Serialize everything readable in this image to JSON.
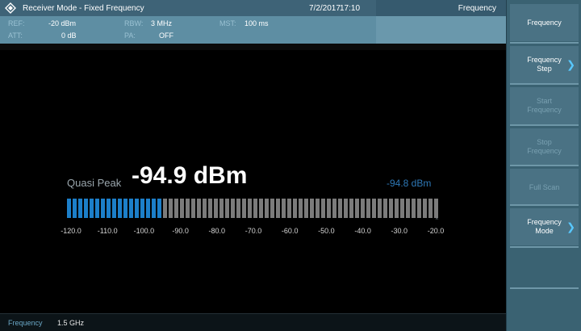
{
  "titlebar": {
    "title": "Receiver Mode - Fixed Frequency",
    "date": "7/2/2017",
    "time": "17:10",
    "right_title": "Frequency"
  },
  "info": {
    "ref_label": "REF:",
    "ref_value": "-20 dBm",
    "rbw_label": "RBW:",
    "rbw_value": "3 MHz",
    "mst_label": "MST:",
    "mst_value": "100 ms",
    "att_label": "ATT:",
    "att_value": "0 dB",
    "pa_label": "PA:",
    "pa_value": "OFF"
  },
  "measurement": {
    "detector_label": "Quasi Peak",
    "main_value": "-94.9 dBm",
    "secondary_value": "-94.8 dBm",
    "bar_min": -120,
    "bar_max": -20,
    "bar_level": -94.9,
    "max_marker": "^",
    "ticks": [
      "-120.0",
      "-110.0",
      "-100.0",
      "-90.0",
      "-80.0",
      "-70.0",
      "-60.0",
      "-50.0",
      "-40.0",
      "-30.0",
      "-20.0"
    ]
  },
  "status": {
    "label": "Frequency",
    "value": "1.5 GHz"
  },
  "softkeys": [
    {
      "label": "Frequency",
      "enabled": true,
      "arrow": ""
    },
    {
      "label": "Frequency\nStep",
      "enabled": true,
      "arrow": "❯"
    },
    {
      "label": "Start\nFrequency",
      "enabled": false,
      "arrow": ""
    },
    {
      "label": "Stop\nFrequency",
      "enabled": false,
      "arrow": ""
    },
    {
      "label": "Full Scan",
      "enabled": false,
      "arrow": ""
    },
    {
      "label": "Frequency\nMode",
      "enabled": true,
      "arrow": "❯"
    }
  ],
  "colors": {
    "bar_active": "#1c7fc9",
    "bar_inactive": "#7b7b7b"
  }
}
